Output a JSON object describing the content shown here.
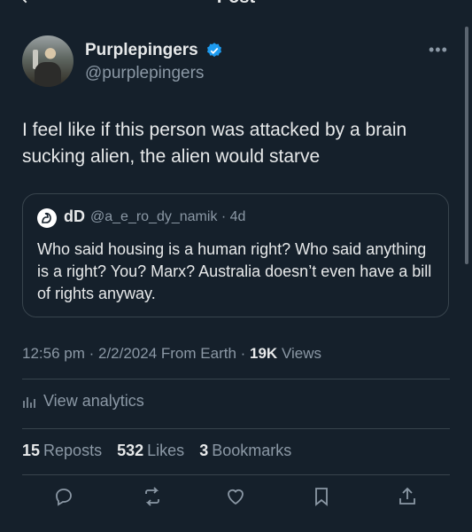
{
  "header": {
    "title": "Post"
  },
  "author": {
    "display_name": "Purplepingers",
    "handle": "@purplepingers"
  },
  "tweet": {
    "text": "I feel like if this person was attacked by a brain sucking alien, the alien would starve"
  },
  "quote": {
    "name": "dD",
    "handle": "@a_e_ro_dy_namik · 4d",
    "text": "Who said housing is a human right? Who said anything is a right? You? Marx? Australia doesn’t even have a bill of rights anyway."
  },
  "meta": {
    "time_date_source": "12:56 pm · 2/2/2024 From Earth · ",
    "views_count": "19K",
    "views_label": "Views"
  },
  "analytics": {
    "label": "View analytics"
  },
  "stats": {
    "reposts_count": "15",
    "reposts_label": "Reposts",
    "likes_count": "532",
    "likes_label": "Likes",
    "bookmarks_count": "3",
    "bookmarks_label": "Bookmarks"
  },
  "colors": {
    "background": "#15202b",
    "text": "#e7e9ea",
    "secondary": "#8b98a5",
    "verified": "#1d9bf0",
    "border": "#38444d"
  },
  "icons": [
    "back-arrow-icon",
    "verified-icon",
    "more-icon",
    "reply-icon",
    "repost-icon",
    "like-icon",
    "bookmark-icon",
    "share-icon",
    "analytics-icon"
  ]
}
